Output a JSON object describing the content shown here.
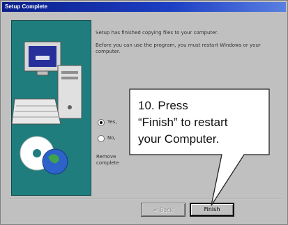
{
  "window": {
    "title": "Setup Complete"
  },
  "message": {
    "line1": "Setup has finished copying files to your computer.",
    "line2": "Before you can use the program, you must restart Windows or your computer."
  },
  "radios": [
    {
      "label": "Yes,",
      "selected": true
    },
    {
      "label": "No,",
      "selected": false
    }
  ],
  "remove_text": "Remove\ncomplete",
  "buttons": {
    "back": "< Back",
    "finish": "Finish"
  },
  "callout": {
    "line1": "10. Press",
    "line2": "“Finish” to restart",
    "line3": "your Computer."
  },
  "colors": {
    "panel": "#1f7d7d",
    "titlebar": "#0a1f8a",
    "window": "#c0c0c0"
  },
  "icons": [
    "monitor-icon",
    "computer-tower-icon",
    "keyboard-icon",
    "disc-globe-icon"
  ]
}
